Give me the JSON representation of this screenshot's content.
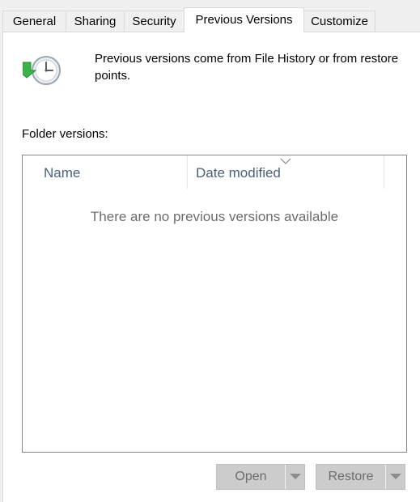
{
  "tabs": [
    {
      "label": "General",
      "active": false
    },
    {
      "label": "Sharing",
      "active": false
    },
    {
      "label": "Security",
      "active": false
    },
    {
      "label": "Previous Versions",
      "active": true
    },
    {
      "label": "Customize",
      "active": false
    }
  ],
  "panel": {
    "intro_text": "Previous versions come from File History or from restore points.",
    "folder_versions_label": "Folder versions:",
    "icon": "file-history-clock-icon"
  },
  "list": {
    "columns": [
      "Name",
      "Date modified"
    ],
    "sort_icon": "sort-chevron-icon",
    "rows": [],
    "empty_message": "There are no previous versions available"
  },
  "buttons": {
    "open": {
      "label": "Open",
      "enabled": false,
      "dropdown_icon": "chevron-down-icon"
    },
    "restore": {
      "label": "Restore",
      "enabled": false,
      "dropdown_icon": "chevron-down-icon"
    }
  },
  "colors": {
    "panel_background": "#ffffff",
    "window_background": "#f0f0f0",
    "header_text": "#4c607a",
    "disabled_button": "#cccccc",
    "disabled_text": "#6d6d6d"
  }
}
